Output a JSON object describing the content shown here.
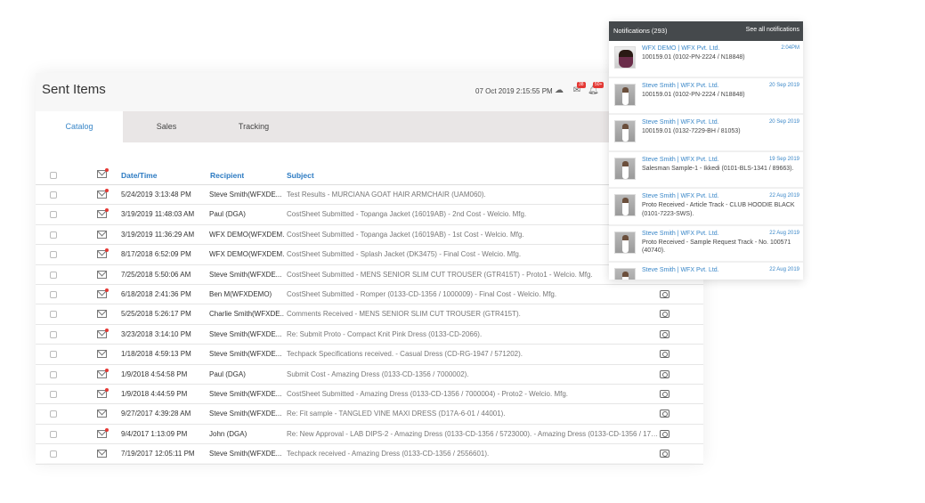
{
  "header": {
    "title": "Sent Items",
    "timestamp": "07 Oct 2019 2:15:55 PM",
    "mail_badge": "38",
    "bell_badge": "50+"
  },
  "tabs": [
    {
      "label": "Catalog",
      "active": true
    },
    {
      "label": "Sales"
    },
    {
      "label": "Tracking"
    }
  ],
  "table": {
    "columns": [
      "Date/Time",
      "Recipient",
      "Subject"
    ],
    "rows": [
      {
        "unread": true,
        "date": "5/24/2019 3:13:48 PM",
        "recipient": "Steve Smith(WFXDE...",
        "subject": "Test Results - MURCIANA GOAT HAIR ARMCHAIR (UAM060)."
      },
      {
        "unread": true,
        "date": "3/19/2019 11:48:03 AM",
        "recipient": "Paul (DGA)",
        "subject": "CostSheet Submitted - Topanga Jacket (16019AB) - 2nd Cost - Welcio. Mfg."
      },
      {
        "unread": false,
        "date": "3/19/2019 11:36:29 AM",
        "recipient": "WFX DEMO(WFXDEM...",
        "subject": "CostSheet Submitted - Topanga Jacket (16019AB) - 1st Cost - Welcio. Mfg."
      },
      {
        "unread": true,
        "date": "8/17/2018 6:52:09 PM",
        "recipient": "WFX DEMO(WFXDEM...",
        "subject": "CostSheet Submitted - Splash Jacket (DK3475) - Final Cost -  Welcio. Mfg."
      },
      {
        "unread": false,
        "date": "7/25/2018 5:50:06 AM",
        "recipient": "Steve Smith(WFXDE...",
        "subject": "CostSheet Submitted - MENS SENIOR SLIM CUT TROUSER (GTR415T) - Proto1 - Welcio. Mfg."
      },
      {
        "unread": true,
        "date": "6/18/2018 2:41:36 PM",
        "recipient": "Ben M(WFXDEMO)",
        "subject": "CostSheet Submitted - Romper (0133-CD-1356 / 1000009) - Final Cost - Welcio. Mfg."
      },
      {
        "unread": false,
        "date": "5/25/2018 5:26:17 PM",
        "recipient": "Charlie Smith(WFXDE...",
        "subject": "Comments Received - MENS SENIOR SLIM CUT TROUSER (GTR415T)."
      },
      {
        "unread": true,
        "date": "3/23/2018 3:14:10 PM",
        "recipient": "Steve Smith(WFXDE...",
        "subject": "Re: Submit Proto - Compact Knit Pink Dress (0133-CD-2066)."
      },
      {
        "unread": false,
        "date": "1/18/2018 4:59:13 PM",
        "recipient": "Steve Smith(WFXDE...",
        "subject": "Techpack Specifications received. - Casual Dress (CD-RG-1947 / 571202)."
      },
      {
        "unread": true,
        "date": "1/9/2018 4:54:58 PM",
        "recipient": "Paul (DGA)",
        "subject": "Submit Cost - Amazing Dress (0133-CD-1356 / 7000002)."
      },
      {
        "unread": true,
        "date": "1/9/2018 4:44:59 PM",
        "recipient": "Steve Smith(WFXDE...",
        "subject": "CostSheet Submitted - Amazing Dress (0133-CD-1356 / 7000004) - Proto2 - Welcio. Mfg."
      },
      {
        "unread": false,
        "date": "9/27/2017 4:39:28 AM",
        "recipient": "Steve Smith(WFXDE...",
        "subject": "Re: Fit sample - TANGLED VINE MAXI DRESS (D17A-6-01 / 44001)."
      },
      {
        "unread": true,
        "date": "9/4/2017 1:13:09 PM",
        "recipient": "John (DGA)",
        "subject": "Re: New Approval - LAB DIPS-2 - Amazing Dress (0133-CD-1356 / 5723000).  - Amazing Dress (0133-CD-1356 / 1732..."
      },
      {
        "unread": false,
        "date": "7/19/2017 12:05:11 PM",
        "recipient": "Steve Smith(WFXDE...",
        "subject": "Techpack received - Amazing Dress (0133-CD-1356 / 2556601)."
      }
    ]
  },
  "notifications": {
    "title": "Notifications (293)",
    "see_all": "See all notifications",
    "items": [
      {
        "from": "WFX DEMO | WFX Pvt. Ltd.",
        "date": "2:04PM",
        "text": "100159.01 (0102-PN-2224 / N18848)",
        "female": true
      },
      {
        "from": "Steve Smith | WFX Pvt. Ltd.",
        "date": "20 Sep 2019",
        "text": "100159.01 (0102-PN-2224 / N18848)"
      },
      {
        "from": "Steve Smith | WFX Pvt. Ltd.",
        "date": "20 Sep 2019",
        "text": "100159.01 (0132-7229-BH / 81053)"
      },
      {
        "from": "Steve Smith | WFX Pvt. Ltd.",
        "date": "19 Sep 2019",
        "text": "Salesman Sample-1 - Ikkedi (0101-BLS-1341 / 89663)."
      },
      {
        "from": "Steve Smith | WFX Pvt. Ltd.",
        "date": "22 Aug 2019",
        "text": "Proto Received - Article Track - CLUB HOODIE BLACK (0101-7223-SWS)."
      },
      {
        "from": "Steve Smith | WFX Pvt. Ltd.",
        "date": "22 Aug 2019",
        "text": "Proto Received - Sample Request Track - No. 100571 (40740)."
      },
      {
        "from": "Steve Smith | WFX Pvt. Ltd.",
        "date": "22 Aug 2019",
        "text": ""
      }
    ]
  }
}
